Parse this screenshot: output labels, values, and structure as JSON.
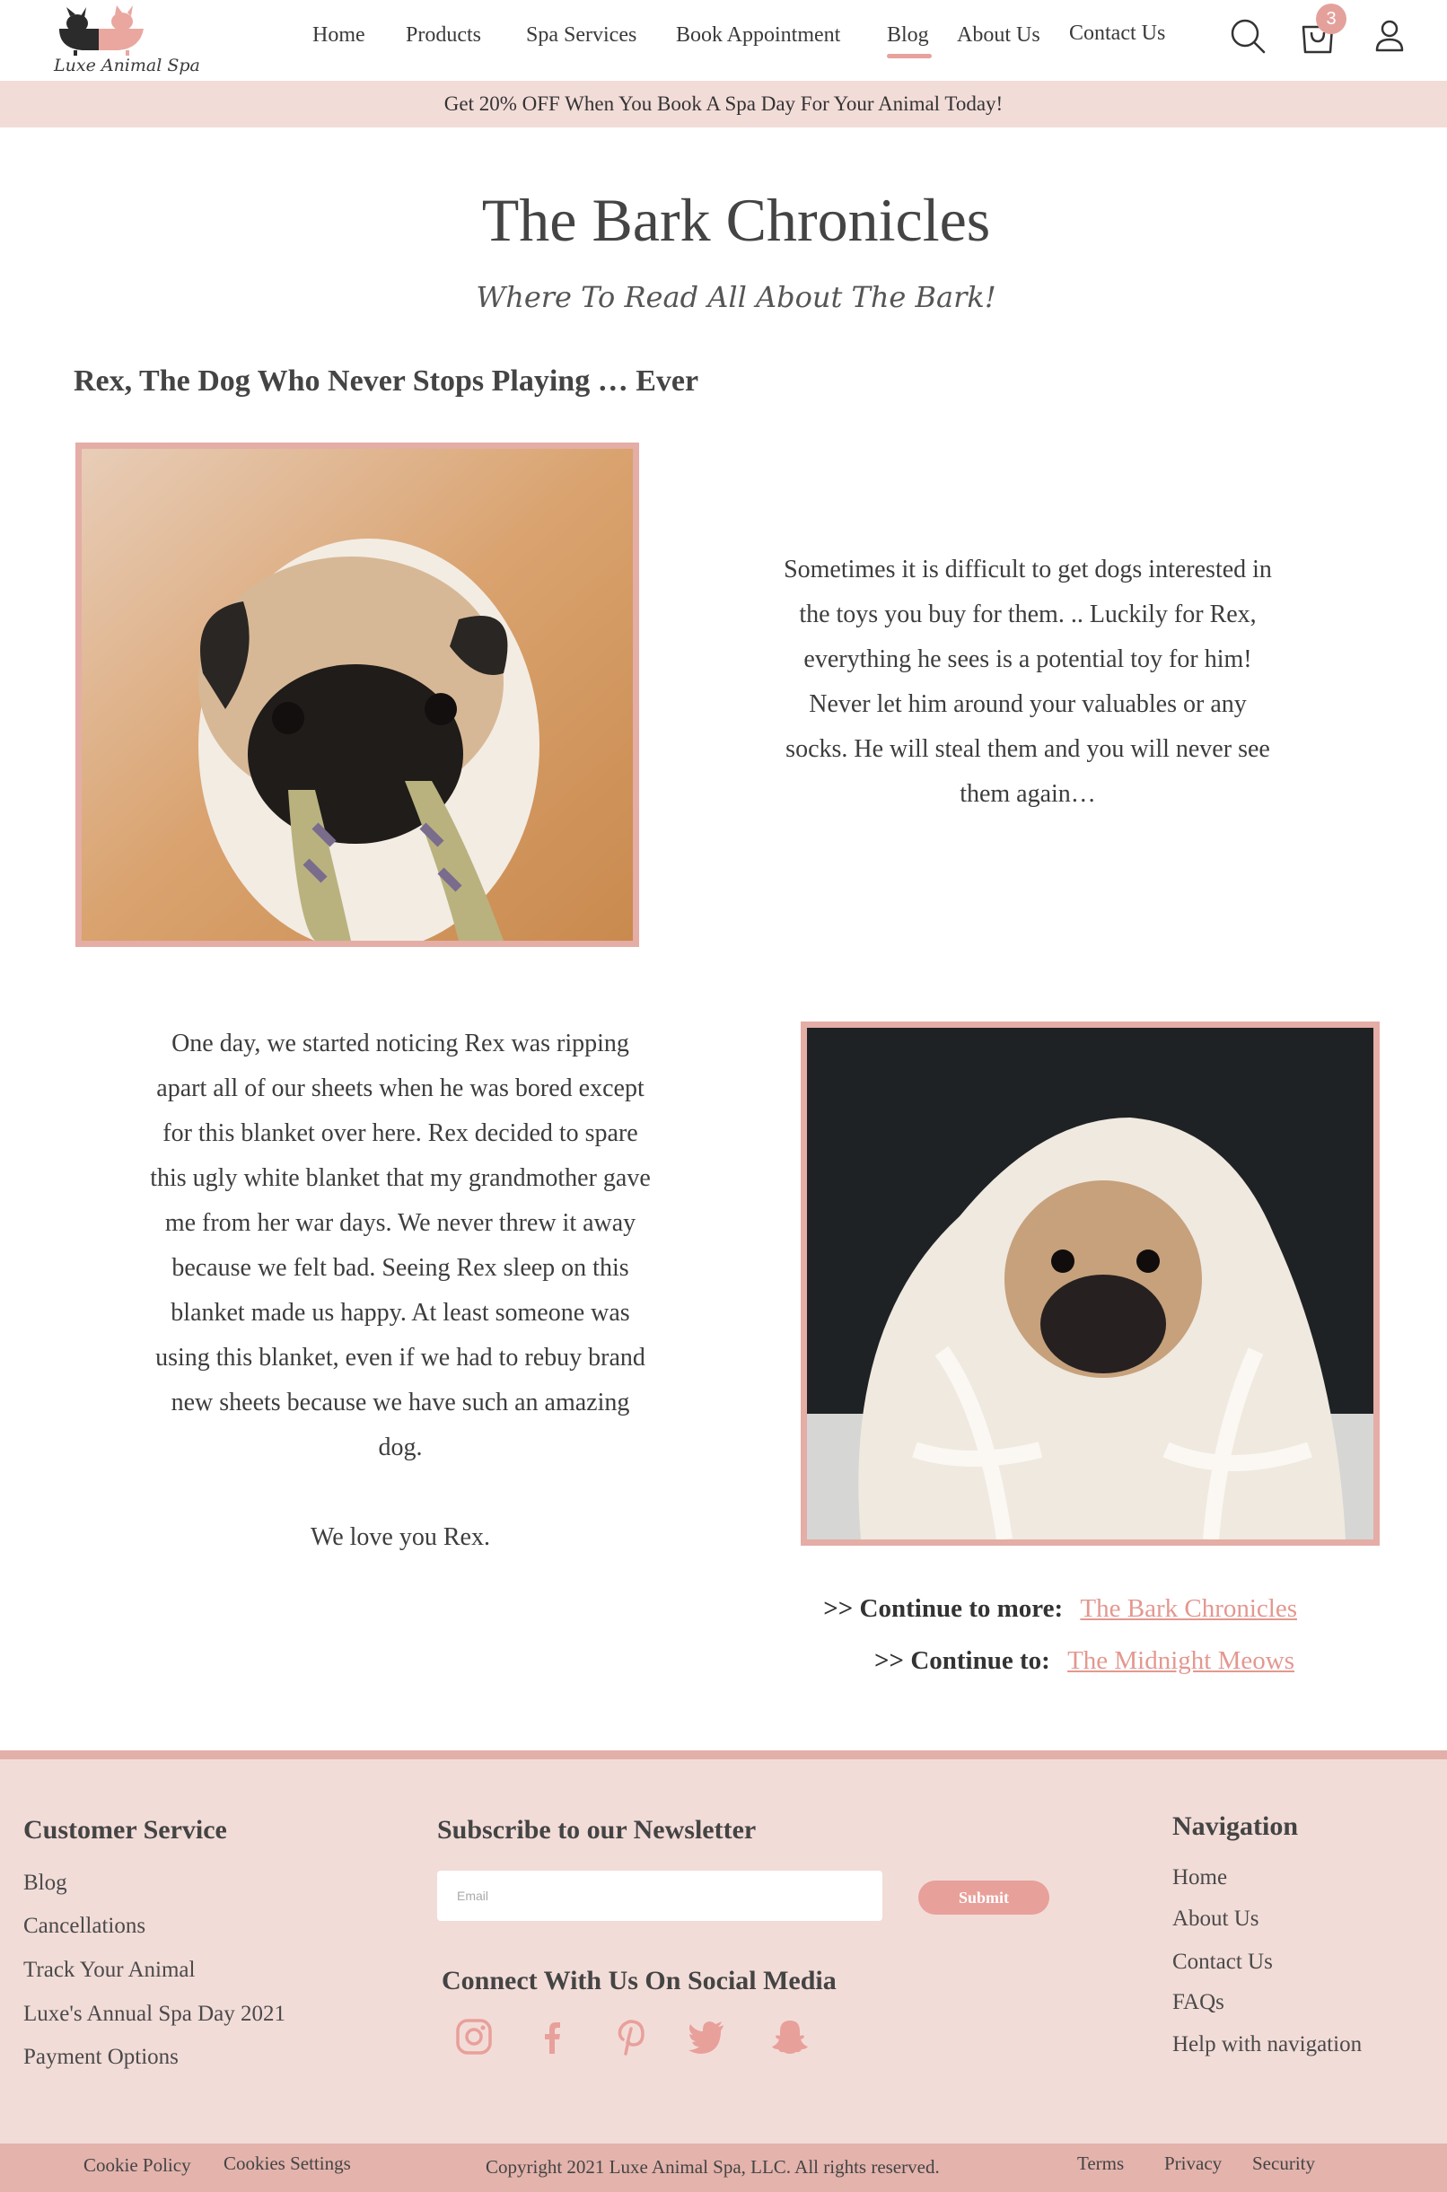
{
  "brand": {
    "name": "Luxe Animal Spa"
  },
  "nav": {
    "items": [
      {
        "label": "Home"
      },
      {
        "label": "Products"
      },
      {
        "label": "Spa Services"
      },
      {
        "label": "Book Appointment"
      },
      {
        "label": "Blog",
        "active": true
      },
      {
        "label": "About Us"
      },
      {
        "label": "Contact Us"
      }
    ],
    "icons": [
      "search-icon",
      "shopping-bag-icon",
      "user-icon"
    ],
    "cart_count": "3"
  },
  "promo": "Get 20% OFF When You Book A Spa Day For Your Animal Today!",
  "blog": {
    "title": "The Bark Chronicles",
    "subtitle": "Where To Read All About The Bark!",
    "post_title": "Rex, The Dog Who Never Stops Playing … Ever",
    "paragraph1": "Sometimes it is difficult to get dogs interested in the toys you buy for them. .. Luckily for Rex, everything he sees is a potential toy for him! Never let him around your valuables or any socks. He will steal them and you will never see them again…",
    "paragraph2": "One day, we started noticing Rex was ripping apart all of our sheets when he was bored except for this blanket over here. Rex decided to spare this ugly white blanket that my grandmother gave me from her war days. We never threw it away because we felt bad. Seeing Rex sleep on this blanket made us happy. At least someone was using this blanket, even if we had to rebuy brand new sheets because we have such an amazing dog.",
    "signoff": "We love you Rex.",
    "continue_more_label": ">> Continue to more:",
    "continue_more_link": "The Bark Chronicles",
    "continue_to_label": ">> Continue to:",
    "continue_to_link": "The Midnight Meows"
  },
  "footer": {
    "customer_service": {
      "heading": "Customer Service",
      "links": [
        "Blog",
        "Cancellations",
        "Track Your Animal",
        "Luxe's Annual Spa Day 2021",
        "Payment Options"
      ]
    },
    "newsletter": {
      "heading": "Subscribe to our Newsletter",
      "email_placeholder": "Email",
      "submit_label": "Submit"
    },
    "social": {
      "heading": "Connect With Us On Social Media",
      "icons": [
        "instagram-icon",
        "facebook-icon",
        "pinterest-icon",
        "twitter-icon",
        "snapchat-icon"
      ]
    },
    "navigation": {
      "heading": "Navigation",
      "links": [
        "Home",
        "About Us",
        "Contact Us",
        "FAQs",
        "Help with navigation"
      ]
    },
    "bottom": {
      "cookie_policy": "Cookie Policy",
      "cookies_settings": "Cookies Settings",
      "copyright": "Copyright 2021 Luxe Animal Spa, LLC. All rights reserved.",
      "terms": "Terms",
      "privacy": "Privacy",
      "security": "Security"
    }
  },
  "colors": {
    "accent": "#e7a29c",
    "promo_bg": "#f2dcd8",
    "footer_bg": "#f2dcd8",
    "frame": "#e4ada6"
  }
}
